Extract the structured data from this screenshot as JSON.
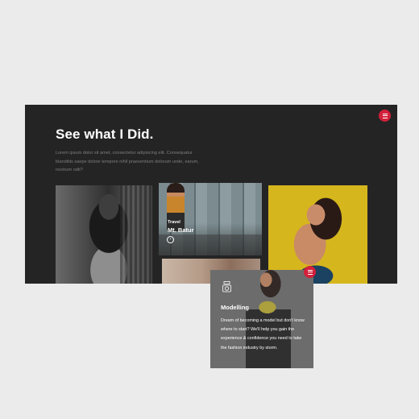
{
  "section": {
    "title": "See what I Did.",
    "description": "Lorem ipsum dolor sit amet, consectetur adipiscing elit. Consequatur blanditiis saepe dolore tempore nihil praesentium dolorum unde, earum, nostrum odit?"
  },
  "tiles": [
    {
      "category": "Travel",
      "title": "Mt. Batur"
    }
  ],
  "card": {
    "title": "Modelling",
    "text": "Dream of becoming a model but don't know where to start? We'll help you gain the experience & confidence you need to take the fashion industry by storm."
  },
  "colors": {
    "accent": "#d3203a",
    "panel": "#252425",
    "card": "#6c6c6c"
  },
  "icons": [
    "menu-icon",
    "arrow-right-icon",
    "camera-icon"
  ]
}
